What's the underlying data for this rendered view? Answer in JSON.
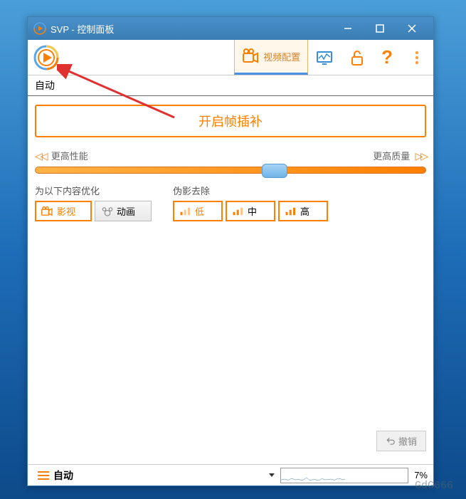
{
  "window": {
    "title": "SVP - 控制面板"
  },
  "toolbar": {
    "video_config_label": "视频配置"
  },
  "profile": {
    "current": "自动"
  },
  "main": {
    "toggle_button_label": "开启帧插补",
    "slider": {
      "left_label": "更高性能",
      "right_label": "更高质量",
      "position_pct": 58
    },
    "optimize": {
      "title": "为以下内容优化",
      "options": [
        {
          "label": "影视",
          "selected": true
        },
        {
          "label": "动画",
          "selected": false
        }
      ]
    },
    "artifact": {
      "title": "伪影去除",
      "options": [
        {
          "label": "低",
          "selected": true
        },
        {
          "label": "中",
          "selected": false
        },
        {
          "label": "高",
          "selected": false
        }
      ]
    },
    "undo_label": "撤销"
  },
  "status": {
    "menu_label": "自动",
    "cpu_pct": "7%"
  },
  "watermark": "GdG666"
}
